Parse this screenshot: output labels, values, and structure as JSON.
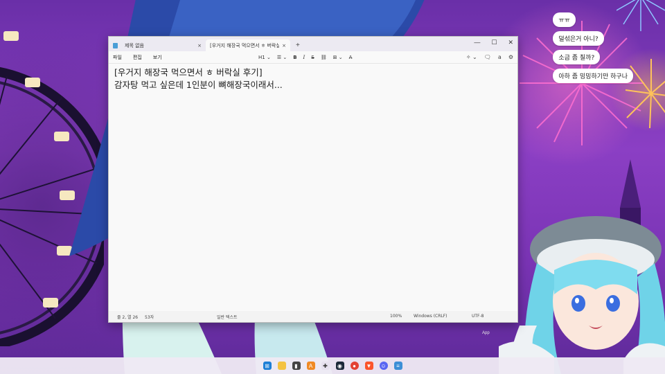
{
  "chat": {
    "messages": [
      "ㅠㅠ",
      "덜섞은거 아니?",
      "소금 좀 칠까?",
      "아하 좀 밍밍하기만 하구나"
    ]
  },
  "window": {
    "tabs": [
      {
        "label": "제목 없음",
        "close": "×"
      },
      {
        "label": "[우거지 해장국 먹으면서 ㅎ 버락실",
        "close": "×"
      }
    ],
    "new_tab": "+",
    "controls": {
      "minimize": "—",
      "maximize": "☐",
      "close": "✕"
    },
    "menu": [
      "파일",
      "편집",
      "보기"
    ],
    "format": {
      "heading": "H1 ⌄",
      "list": "☰ ⌄",
      "bold": "B",
      "italic": "I",
      "strike": "S",
      "link": "⛓",
      "table": "⊞ ⌄",
      "clear": "A̶"
    },
    "right_tools": {
      "copilot": "✧ ⌄",
      "notes": "🗨",
      "account": "a",
      "settings": "⚙"
    },
    "content_lines": [
      "[우거지 해장국 먹으면서 ㅎ 버락실 후기]",
      "감자탕 먹고 싶은데 1인분이 뼈해장국이래서..."
    ],
    "status": {
      "position": "줄 2, 열 26",
      "chars": "53자",
      "format": "일반 텍스트",
      "zoom": "100%",
      "line_ending": "Windows (CRLF)",
      "encoding": "UTF-8"
    }
  },
  "desktop": {
    "app_label": "App"
  },
  "taskbar": {
    "icons": [
      "windows-start",
      "file-explorer",
      "terminal",
      "app-a",
      "share",
      "steam",
      "chrome",
      "brave",
      "discord",
      "notepad"
    ]
  }
}
